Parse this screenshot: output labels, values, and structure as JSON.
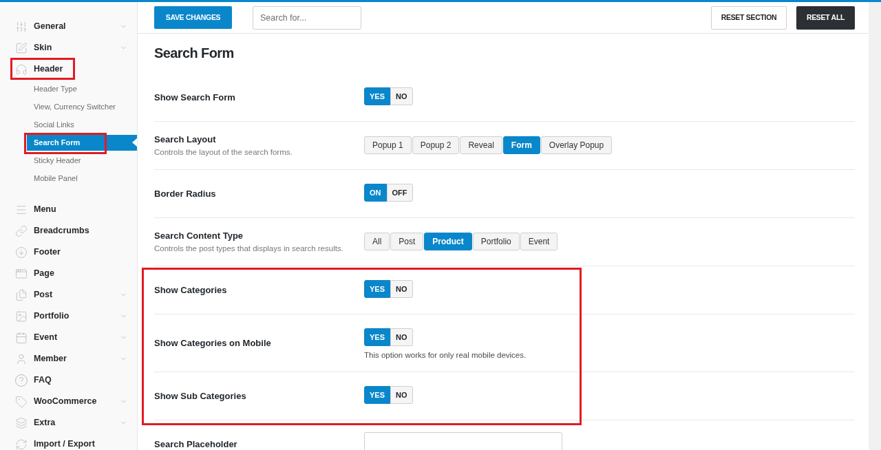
{
  "sidebar": {
    "items": [
      {
        "label": "General",
        "expanded": false,
        "highlighted": false
      },
      {
        "label": "Skin",
        "expanded": false,
        "highlighted": false
      },
      {
        "label": "Header",
        "expanded": true,
        "highlighted": true,
        "children": [
          {
            "label": "Header Type",
            "selected": false,
            "highlighted": false
          },
          {
            "label": "View, Currency Switcher",
            "selected": false,
            "highlighted": false
          },
          {
            "label": "Social Links",
            "selected": false,
            "highlighted": false
          },
          {
            "label": "Search Form",
            "selected": true,
            "highlighted": true
          },
          {
            "label": "Sticky Header",
            "selected": false,
            "highlighted": false
          },
          {
            "label": "Mobile Panel",
            "selected": false,
            "highlighted": false
          }
        ]
      },
      {
        "label": "Menu",
        "highlighted": false
      },
      {
        "label": "Breadcrumbs",
        "highlighted": false
      },
      {
        "label": "Footer",
        "highlighted": false
      },
      {
        "label": "Page",
        "highlighted": false
      },
      {
        "label": "Post",
        "expanded": false,
        "highlighted": false
      },
      {
        "label": "Portfolio",
        "expanded": false,
        "highlighted": false
      },
      {
        "label": "Event",
        "expanded": false,
        "highlighted": false
      },
      {
        "label": "Member",
        "expanded": false,
        "highlighted": false
      },
      {
        "label": "FAQ",
        "highlighted": false
      },
      {
        "label": "WooCommerce",
        "expanded": false,
        "highlighted": false
      },
      {
        "label": "Extra",
        "expanded": false,
        "highlighted": false
      },
      {
        "label": "Import / Export",
        "highlighted": false
      }
    ]
  },
  "toolbar": {
    "save_button": "SAVE CHANGES",
    "search": {
      "placeholder": "Search for..."
    },
    "reset_section_button": "RESET SECTION",
    "reset_all_button": "RESET ALL"
  },
  "page": {
    "title": "Search Form",
    "rows": [
      {
        "label": "Show Search Form",
        "kind": "toggle",
        "options": [
          {
            "label": "YES",
            "selected": true
          },
          {
            "label": "NO",
            "selected": false
          }
        ],
        "highlighted": false
      },
      {
        "label": "Search Layout",
        "description": "Controls the layout of the search forms.",
        "kind": "buttons",
        "options": [
          {
            "label": "Popup 1",
            "selected": false
          },
          {
            "label": "Popup 2",
            "selected": false
          },
          {
            "label": "Reveal",
            "selected": false
          },
          {
            "label": "Form",
            "selected": true
          },
          {
            "label": "Overlay Popup",
            "selected": false
          }
        ],
        "highlighted": false
      },
      {
        "label": "Border Radius",
        "kind": "toggle",
        "options": [
          {
            "label": "ON",
            "selected": true
          },
          {
            "label": "OFF",
            "selected": false
          }
        ],
        "highlighted": false
      },
      {
        "label": "Search Content Type",
        "description": "Controls the post types that displays in search results.",
        "kind": "buttons",
        "options": [
          {
            "label": "All",
            "selected": false
          },
          {
            "label": "Post",
            "selected": false
          },
          {
            "label": "Product",
            "selected": true
          },
          {
            "label": "Portfolio",
            "selected": false
          },
          {
            "label": "Event",
            "selected": false
          }
        ],
        "highlighted": false
      },
      {
        "label": "Show Categories",
        "kind": "toggle",
        "options": [
          {
            "label": "YES",
            "selected": true
          },
          {
            "label": "NO",
            "selected": false
          }
        ],
        "highlighted": true
      },
      {
        "label": "Show Categories on Mobile",
        "kind": "toggle",
        "options": [
          {
            "label": "YES",
            "selected": true
          },
          {
            "label": "NO",
            "selected": false
          }
        ],
        "note": "This option works for only real mobile devices.",
        "highlighted": true
      },
      {
        "label": "Show Sub Categories",
        "kind": "toggle",
        "options": [
          {
            "label": "YES",
            "selected": true
          },
          {
            "label": "NO",
            "selected": false
          }
        ],
        "highlighted": true
      },
      {
        "label": "Search Placeholder",
        "kind": "input",
        "highlighted": false
      }
    ]
  }
}
